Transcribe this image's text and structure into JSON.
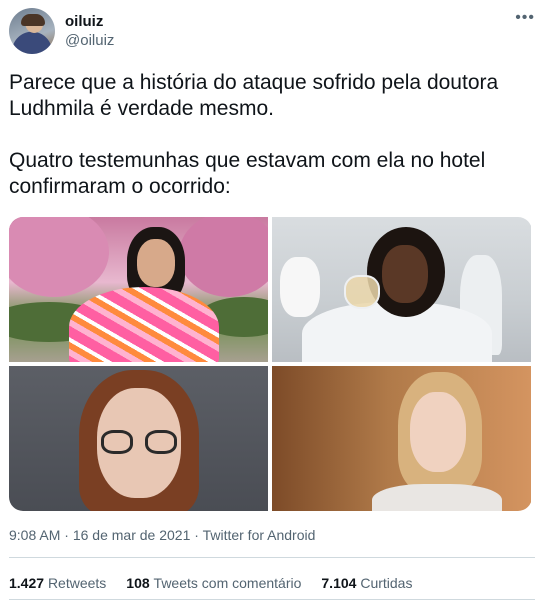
{
  "author": {
    "display_name": "oiluiz",
    "handle": "@oiluiz",
    "avatar_icon": "user-avatar"
  },
  "menu": {
    "more_label": "•••",
    "more_icon": "more-options-icon"
  },
  "tweet": {
    "text": "Parece que a história do ataque sofrido pela doutora\nLudhmila é verdade mesmo.\n\nQuatro testemunhas que estavam com ela no hotel\nconfirmaram o ocorrido:"
  },
  "photos": [
    {
      "name": "photo-woman-flowers"
    },
    {
      "name": "photo-scientist-lab"
    },
    {
      "name": "photo-woman-glasses"
    },
    {
      "name": "photo-blonde-woman"
    }
  ],
  "meta": {
    "time": "9:08 AM",
    "date": "16 de mar de 2021",
    "source": "Twitter for Android",
    "separator": "·"
  },
  "stats": {
    "retweets_count": "1.427",
    "retweets_label": "Retweets",
    "quotes_count": "108",
    "quotes_label": "Tweets com comentário",
    "likes_count": "7.104",
    "likes_label": "Curtidas"
  },
  "colors": {
    "text_primary": "#0f1419",
    "text_secondary": "#536471",
    "divider": "#cfd9de",
    "background": "#ffffff"
  }
}
